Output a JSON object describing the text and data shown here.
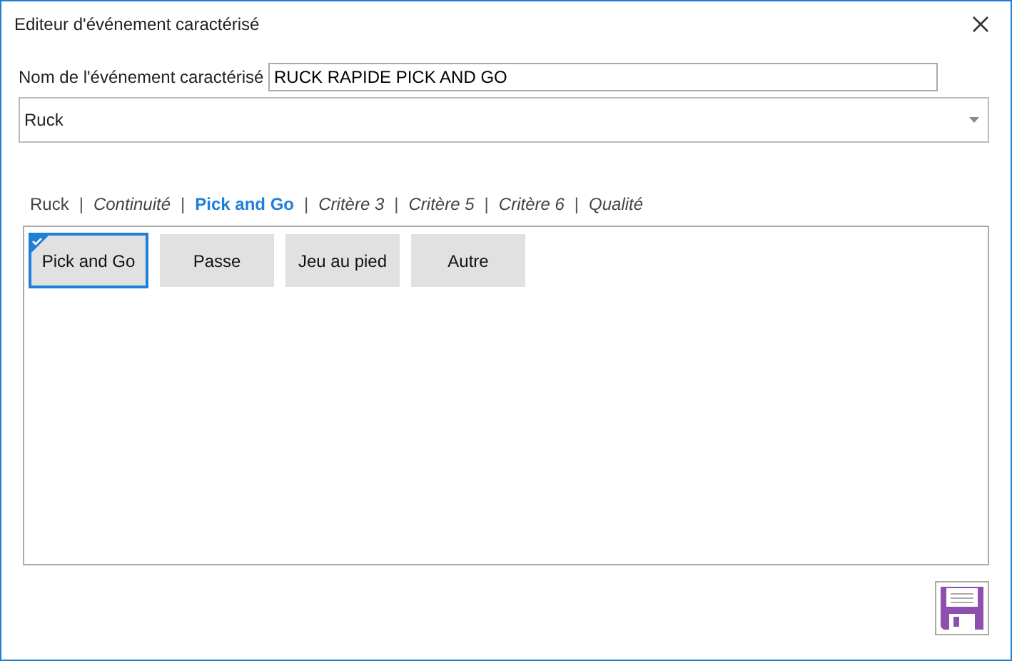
{
  "window": {
    "title": "Editeur d'événement caractérisé"
  },
  "name_field": {
    "label": "Nom de l'événement caractérisé",
    "value": "RUCK RAPIDE PICK AND GO"
  },
  "category_dropdown": {
    "value": "Ruck"
  },
  "tab_separator": "|",
  "tabs": [
    {
      "label": "Ruck",
      "selected": false,
      "italic": false
    },
    {
      "label": "Continuité",
      "selected": false,
      "italic": true
    },
    {
      "label": "Pick and Go",
      "selected": true,
      "italic": false
    },
    {
      "label": "Critère 3",
      "selected": false,
      "italic": true
    },
    {
      "label": "Critère 5",
      "selected": false,
      "italic": true
    },
    {
      "label": "Critère 6",
      "selected": false,
      "italic": true
    },
    {
      "label": "Qualité",
      "selected": false,
      "italic": true
    }
  ],
  "options": [
    {
      "label": "Pick and Go",
      "selected": true
    },
    {
      "label": "Passe",
      "selected": false
    },
    {
      "label": "Jeu au pied",
      "selected": false
    },
    {
      "label": "Autre",
      "selected": false
    }
  ]
}
